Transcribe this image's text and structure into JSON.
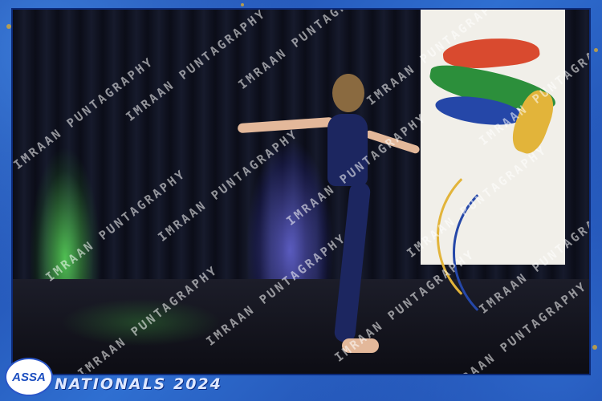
{
  "watermark": {
    "text": "IMRAAN PUNTAGRAPHY"
  },
  "event": {
    "title": "NATIONALS 2024"
  },
  "logo": {
    "text": "ASSA"
  },
  "colors": {
    "frame": "#1b3fa8",
    "accent_gold": "#d4a934"
  }
}
